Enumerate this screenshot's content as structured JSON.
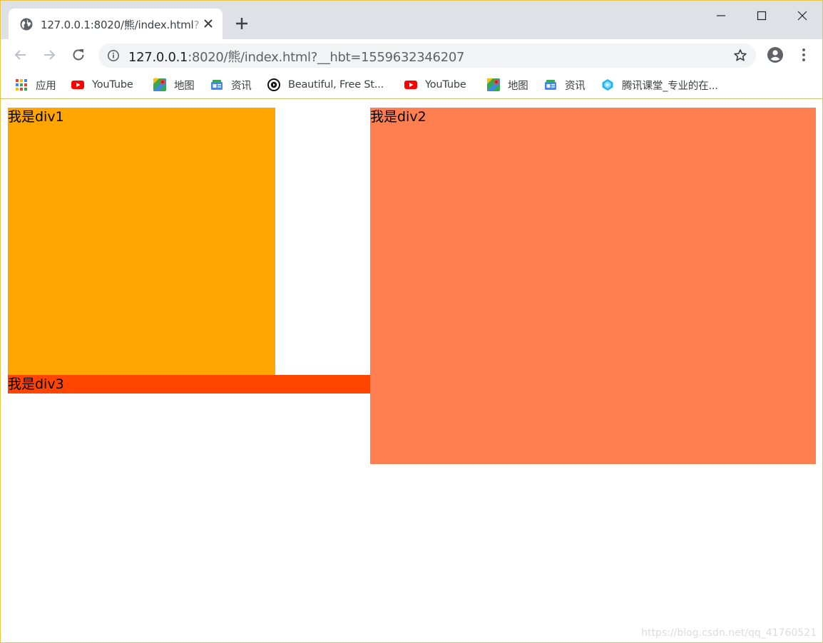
{
  "tab": {
    "title": "127.0.0.1:8020/熊/index.html",
    "title_faded": "?_"
  },
  "toolbar": {
    "url_host": "127.0.0.1",
    "url_path": ":8020/熊/index.html?__hbt=1559632346207"
  },
  "bookmarks": [
    {
      "label": "应用",
      "icon": "apps-grid-icon"
    },
    {
      "label": "YouTube",
      "icon": "youtube-icon"
    },
    {
      "label": "地图",
      "icon": "maps-icon"
    },
    {
      "label": "资讯",
      "icon": "news-icon"
    },
    {
      "label": "Beautiful, Free St...",
      "icon": "unsplash-icon"
    },
    {
      "label": "YouTube",
      "icon": "youtube-icon"
    },
    {
      "label": "地图",
      "icon": "maps-icon"
    },
    {
      "label": "资讯",
      "icon": "news-icon"
    },
    {
      "label": "腾讯课堂_专业的在...",
      "icon": "tencent-classroom-icon"
    }
  ],
  "page": {
    "div1": {
      "text": "我是div1",
      "color": "#ffa500"
    },
    "div2": {
      "text": "我是div2",
      "color": "#ff7f50"
    },
    "div3": {
      "text": "我是div3",
      "color": "#ff4500"
    },
    "watermark": "https://blog.csdn.net/qq_41760521"
  },
  "colors": {
    "tabstrip": "#dee1e6",
    "omnibox": "#f1f3f4",
    "window_border": "#e8c44a"
  }
}
